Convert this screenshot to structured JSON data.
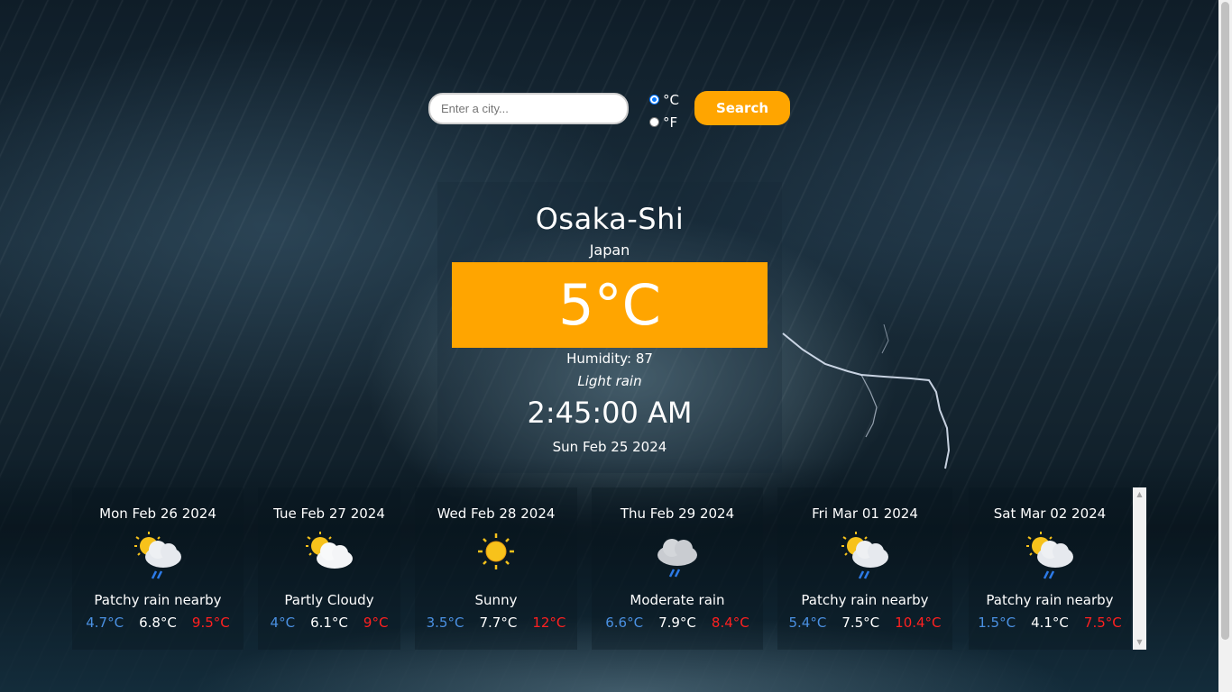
{
  "search": {
    "placeholder": "Enter a city...",
    "button_label": "Search",
    "units": [
      {
        "label": "°C",
        "checked": true
      },
      {
        "label": "°F",
        "checked": false
      }
    ]
  },
  "current": {
    "city": "Osaka-Shi",
    "country": "Japan",
    "temperature": "5°C",
    "humidity": "Humidity: 87",
    "condition": "Light rain",
    "time": "2:45:00 AM",
    "date": "Sun Feb 25 2024"
  },
  "forecast": [
    {
      "date": "Mon Feb 26 2024",
      "icon": "patchy-rain-icon",
      "condition": "Patchy rain nearby",
      "min": "4.7°C",
      "avg": "6.8°C",
      "max": "9.5°C"
    },
    {
      "date": "Tue Feb 27 2024",
      "icon": "partly-cloudy-icon",
      "condition": "Partly Cloudy",
      "min": "4°C",
      "avg": "6.1°C",
      "max": "9°C"
    },
    {
      "date": "Wed Feb 28 2024",
      "icon": "sunny-icon",
      "condition": "Sunny",
      "min": "3.5°C",
      "avg": "7.7°C",
      "max": "12°C"
    },
    {
      "date": "Thu Feb 29 2024",
      "icon": "moderate-rain-icon",
      "condition": "Moderate rain",
      "min": "6.6°C",
      "avg": "7.9°C",
      "max": "8.4°C"
    },
    {
      "date": "Fri Mar 01 2024",
      "icon": "patchy-rain-icon",
      "condition": "Patchy rain nearby",
      "min": "5.4°C",
      "avg": "7.5°C",
      "max": "10.4°C"
    },
    {
      "date": "Sat Mar 02 2024",
      "icon": "patchy-rain-icon",
      "condition": "Patchy rain nearby",
      "min": "1.5°C",
      "avg": "4.1°C",
      "max": "7.5°C"
    }
  ],
  "colors": {
    "accent": "#ffa500",
    "min_temp": "#4a90e2",
    "max_temp": "#ff2020"
  }
}
